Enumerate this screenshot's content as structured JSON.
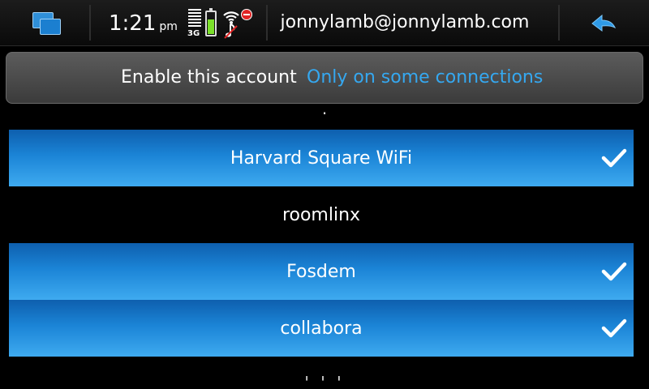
{
  "statusbar": {
    "time": "1:21",
    "ampm": "pm",
    "network": "3G",
    "account": "jonnylamb@jonnylamb.com",
    "battery_level": 0.7,
    "icons": [
      "task-switcher-icon",
      "signal-icon",
      "battery-icon",
      "wifi-icon",
      "alert-icon",
      "music-note-icon",
      "back-arrow-icon"
    ]
  },
  "account_bar": {
    "label": "Enable this account",
    "value": "Only on some connections"
  },
  "connections": [
    {
      "name": "Harvard Square WiFi",
      "selected": true
    },
    {
      "name": "roomlinx",
      "selected": false
    },
    {
      "name": "Fosdem",
      "selected": true
    },
    {
      "name": "collabora",
      "selected": true
    }
  ],
  "colors": {
    "accent": "#35a8f0",
    "selected_row": "#1b84d6",
    "battery": "#7be02a",
    "alert": "#e02525"
  }
}
